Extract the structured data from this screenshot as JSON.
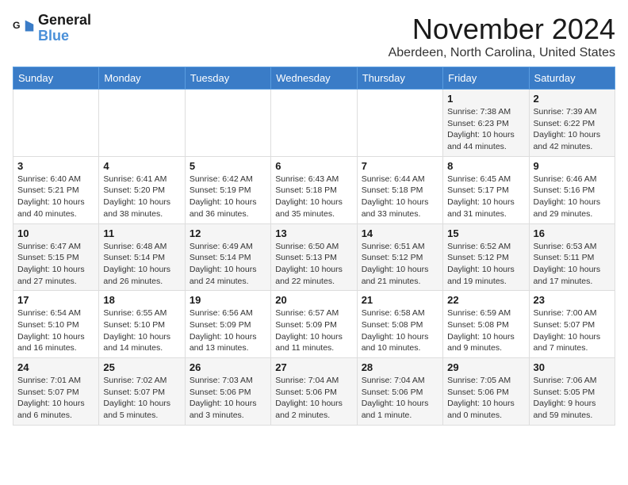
{
  "logo": {
    "text_general": "General",
    "text_blue": "Blue"
  },
  "header": {
    "month": "November 2024",
    "location": "Aberdeen, North Carolina, United States"
  },
  "weekdays": [
    "Sunday",
    "Monday",
    "Tuesday",
    "Wednesday",
    "Thursday",
    "Friday",
    "Saturday"
  ],
  "weeks": [
    [
      {
        "day": "",
        "info": ""
      },
      {
        "day": "",
        "info": ""
      },
      {
        "day": "",
        "info": ""
      },
      {
        "day": "",
        "info": ""
      },
      {
        "day": "",
        "info": ""
      },
      {
        "day": "1",
        "info": "Sunrise: 7:38 AM\nSunset: 6:23 PM\nDaylight: 10 hours\nand 44 minutes."
      },
      {
        "day": "2",
        "info": "Sunrise: 7:39 AM\nSunset: 6:22 PM\nDaylight: 10 hours\nand 42 minutes."
      }
    ],
    [
      {
        "day": "3",
        "info": "Sunrise: 6:40 AM\nSunset: 5:21 PM\nDaylight: 10 hours\nand 40 minutes."
      },
      {
        "day": "4",
        "info": "Sunrise: 6:41 AM\nSunset: 5:20 PM\nDaylight: 10 hours\nand 38 minutes."
      },
      {
        "day": "5",
        "info": "Sunrise: 6:42 AM\nSunset: 5:19 PM\nDaylight: 10 hours\nand 36 minutes."
      },
      {
        "day": "6",
        "info": "Sunrise: 6:43 AM\nSunset: 5:18 PM\nDaylight: 10 hours\nand 35 minutes."
      },
      {
        "day": "7",
        "info": "Sunrise: 6:44 AM\nSunset: 5:18 PM\nDaylight: 10 hours\nand 33 minutes."
      },
      {
        "day": "8",
        "info": "Sunrise: 6:45 AM\nSunset: 5:17 PM\nDaylight: 10 hours\nand 31 minutes."
      },
      {
        "day": "9",
        "info": "Sunrise: 6:46 AM\nSunset: 5:16 PM\nDaylight: 10 hours\nand 29 minutes."
      }
    ],
    [
      {
        "day": "10",
        "info": "Sunrise: 6:47 AM\nSunset: 5:15 PM\nDaylight: 10 hours\nand 27 minutes."
      },
      {
        "day": "11",
        "info": "Sunrise: 6:48 AM\nSunset: 5:14 PM\nDaylight: 10 hours\nand 26 minutes."
      },
      {
        "day": "12",
        "info": "Sunrise: 6:49 AM\nSunset: 5:14 PM\nDaylight: 10 hours\nand 24 minutes."
      },
      {
        "day": "13",
        "info": "Sunrise: 6:50 AM\nSunset: 5:13 PM\nDaylight: 10 hours\nand 22 minutes."
      },
      {
        "day": "14",
        "info": "Sunrise: 6:51 AM\nSunset: 5:12 PM\nDaylight: 10 hours\nand 21 minutes."
      },
      {
        "day": "15",
        "info": "Sunrise: 6:52 AM\nSunset: 5:12 PM\nDaylight: 10 hours\nand 19 minutes."
      },
      {
        "day": "16",
        "info": "Sunrise: 6:53 AM\nSunset: 5:11 PM\nDaylight: 10 hours\nand 17 minutes."
      }
    ],
    [
      {
        "day": "17",
        "info": "Sunrise: 6:54 AM\nSunset: 5:10 PM\nDaylight: 10 hours\nand 16 minutes."
      },
      {
        "day": "18",
        "info": "Sunrise: 6:55 AM\nSunset: 5:10 PM\nDaylight: 10 hours\nand 14 minutes."
      },
      {
        "day": "19",
        "info": "Sunrise: 6:56 AM\nSunset: 5:09 PM\nDaylight: 10 hours\nand 13 minutes."
      },
      {
        "day": "20",
        "info": "Sunrise: 6:57 AM\nSunset: 5:09 PM\nDaylight: 10 hours\nand 11 minutes."
      },
      {
        "day": "21",
        "info": "Sunrise: 6:58 AM\nSunset: 5:08 PM\nDaylight: 10 hours\nand 10 minutes."
      },
      {
        "day": "22",
        "info": "Sunrise: 6:59 AM\nSunset: 5:08 PM\nDaylight: 10 hours\nand 9 minutes."
      },
      {
        "day": "23",
        "info": "Sunrise: 7:00 AM\nSunset: 5:07 PM\nDaylight: 10 hours\nand 7 minutes."
      }
    ],
    [
      {
        "day": "24",
        "info": "Sunrise: 7:01 AM\nSunset: 5:07 PM\nDaylight: 10 hours\nand 6 minutes."
      },
      {
        "day": "25",
        "info": "Sunrise: 7:02 AM\nSunset: 5:07 PM\nDaylight: 10 hours\nand 5 minutes."
      },
      {
        "day": "26",
        "info": "Sunrise: 7:03 AM\nSunset: 5:06 PM\nDaylight: 10 hours\nand 3 minutes."
      },
      {
        "day": "27",
        "info": "Sunrise: 7:04 AM\nSunset: 5:06 PM\nDaylight: 10 hours\nand 2 minutes."
      },
      {
        "day": "28",
        "info": "Sunrise: 7:04 AM\nSunset: 5:06 PM\nDaylight: 10 hours\nand 1 minute."
      },
      {
        "day": "29",
        "info": "Sunrise: 7:05 AM\nSunset: 5:06 PM\nDaylight: 10 hours\nand 0 minutes."
      },
      {
        "day": "30",
        "info": "Sunrise: 7:06 AM\nSunset: 5:05 PM\nDaylight: 9 hours\nand 59 minutes."
      }
    ]
  ]
}
